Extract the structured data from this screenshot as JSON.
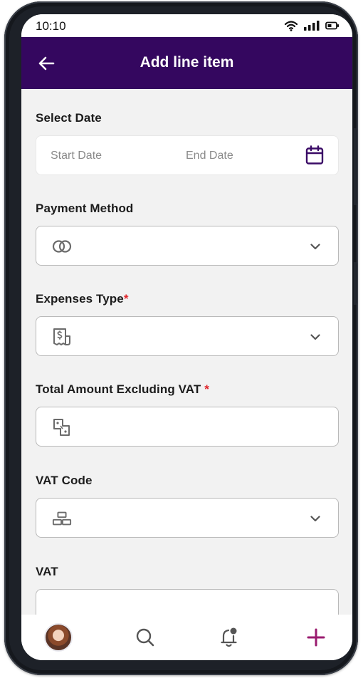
{
  "status_bar": {
    "time": "10:10",
    "icons": [
      "wifi-icon",
      "signal-icon",
      "battery-icon"
    ]
  },
  "header": {
    "title": "Add line item",
    "back_icon": "arrow-left-icon"
  },
  "form": {
    "select_date": {
      "label": "Select Date",
      "start_placeholder": "Start Date",
      "end_placeholder": "End Date",
      "icon": "calendar-icon"
    },
    "payment_method": {
      "label": "Payment Method",
      "icon": "card-rings-icon",
      "value": ""
    },
    "expenses_type": {
      "label": "Expenses Type",
      "required_mark": "*",
      "icon": "receipt-icon",
      "value": ""
    },
    "total_amount": {
      "label": "Total Amount Excluding VAT",
      "required_mark": "*",
      "icon": "amount-icon",
      "value": ""
    },
    "vat_code": {
      "label": "VAT Code",
      "icon": "blocks-icon",
      "value": ""
    },
    "vat": {
      "label": "VAT",
      "value": ""
    }
  },
  "bottom_nav": {
    "items": [
      "profile-avatar",
      "search-icon",
      "notification-bell-icon",
      "add-icon"
    ]
  },
  "colors": {
    "header_bg": "#34075f",
    "accent": "#9a1b6f",
    "required": "#e0262c",
    "calendar": "#3a0b66"
  }
}
